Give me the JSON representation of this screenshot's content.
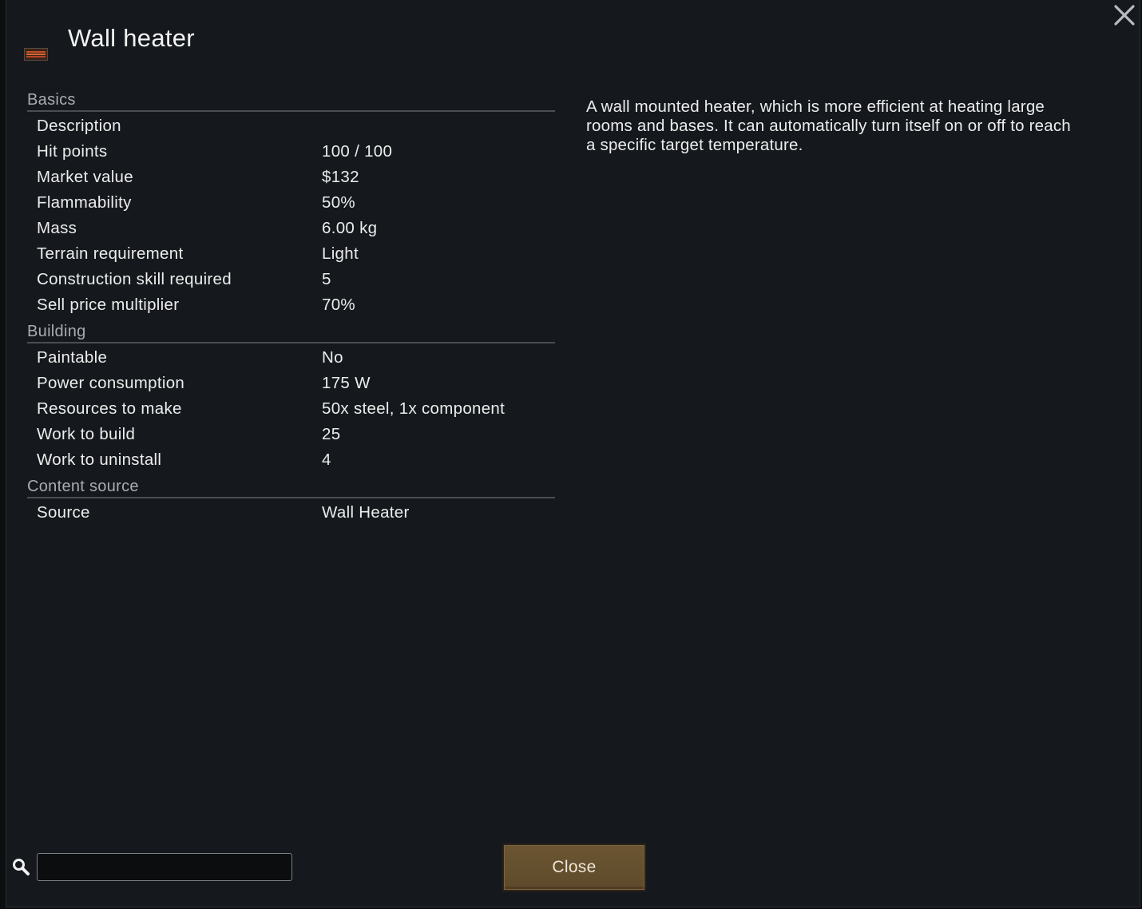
{
  "window": {
    "title": "Wall heater",
    "description": "A wall mounted heater, which is more efficient at heating large rooms and bases. It can automatically turn itself on or off to reach a specific target temperature."
  },
  "sections": [
    {
      "header": "Basics",
      "rows": [
        {
          "label": "Description",
          "value": ""
        },
        {
          "label": "Hit points",
          "value": "100 / 100"
        },
        {
          "label": "Market value",
          "value": "$132"
        },
        {
          "label": "Flammability",
          "value": "50%"
        },
        {
          "label": "Mass",
          "value": "6.00 kg"
        },
        {
          "label": "Terrain requirement",
          "value": "Light"
        },
        {
          "label": "Construction skill required",
          "value": "5"
        },
        {
          "label": "Sell price multiplier",
          "value": "70%"
        }
      ]
    },
    {
      "header": "Building",
      "rows": [
        {
          "label": "Paintable",
          "value": "No"
        },
        {
          "label": "Power consumption",
          "value": "175 W"
        },
        {
          "label": "Resources to make",
          "value": "50x steel, 1x component"
        },
        {
          "label": "Work to build",
          "value": "25"
        },
        {
          "label": "Work to uninstall",
          "value": "4"
        }
      ]
    },
    {
      "header": "Content source",
      "rows": [
        {
          "label": "Source",
          "value": "Wall Heater"
        }
      ]
    }
  ],
  "search": {
    "value": "",
    "placeholder": ""
  },
  "footer": {
    "close_label": "Close"
  },
  "icons": {
    "close": "close-x-icon",
    "search": "magnifier-icon",
    "thing": "wall-heater-icon"
  },
  "colors": {
    "background": "#15191d",
    "button": "#6b5532",
    "section_header": "#a9adb1"
  }
}
